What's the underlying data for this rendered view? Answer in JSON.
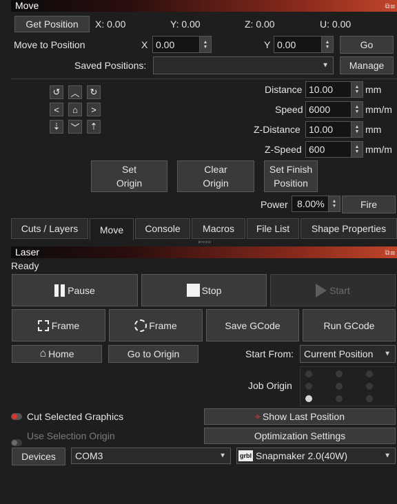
{
  "move_panel": {
    "title": "Move",
    "get_position_label": "Get Position",
    "positions": {
      "x": "X: 0.00",
      "y": "Y: 0.00",
      "z": "Z: 0.00",
      "u": "U: 0.00"
    },
    "move_to_position_label": "Move to Position",
    "x_label": "X",
    "x_value": "0.00",
    "y_label": "Y",
    "y_value": "0.00",
    "go_label": "Go",
    "saved_positions_label": "Saved Positions:",
    "saved_positions_value": "",
    "manage_label": "Manage",
    "distance_label": "Distance",
    "distance_value": "10.00",
    "distance_unit": "mm",
    "speed_label": "Speed",
    "speed_value": "6000",
    "speed_unit": "mm/m",
    "z_distance_label": "Z-Distance",
    "z_distance_value": "10.00",
    "z_distance_unit": "mm",
    "z_speed_label": "Z-Speed",
    "z_speed_value": "600",
    "z_speed_unit": "mm/m",
    "set_origin_line1": "Set",
    "set_origin_line2": "Origin",
    "clear_origin_line1": "Clear",
    "clear_origin_line2": "Origin",
    "set_finish_line1": "Set Finish",
    "set_finish_line2": "Position",
    "power_label": "Power",
    "power_value": "8.00%",
    "fire_label": "Fire"
  },
  "tabs": [
    {
      "label": "Cuts / Layers"
    },
    {
      "label": "Move"
    },
    {
      "label": "Console"
    },
    {
      "label": "Macros"
    },
    {
      "label": "File List"
    },
    {
      "label": "Shape Properties"
    }
  ],
  "active_tab": "Move",
  "laser_panel": {
    "title": "Laser",
    "status": "Ready",
    "pause_label": "Pause",
    "stop_label": "Stop",
    "start_label": "Start",
    "frame_rect_label": "Frame",
    "frame_circle_label": "Frame",
    "save_gcode_label": "Save GCode",
    "run_gcode_label": "Run GCode",
    "home_label": "Home",
    "go_to_origin_label": "Go to Origin",
    "start_from_label": "Start From:",
    "start_from_value": "Current Position",
    "job_origin_label": "Job Origin",
    "job_origin_selected": "bottom-left",
    "cut_selected_label": "Cut Selected Graphics",
    "cut_selected_on": true,
    "use_selection_origin_label": "Use Selection Origin",
    "use_selection_origin_on": false,
    "show_last_position_label": "Show Last Position",
    "optimization_settings_label": "Optimization Settings",
    "devices_label": "Devices",
    "port_value": "COM3",
    "device_value": "Snapmaker 2.0(40W)",
    "device_badge": "grbl"
  },
  "colors": {
    "accent_toggle_on": "#d9362b",
    "background": "#1e1e1e"
  }
}
